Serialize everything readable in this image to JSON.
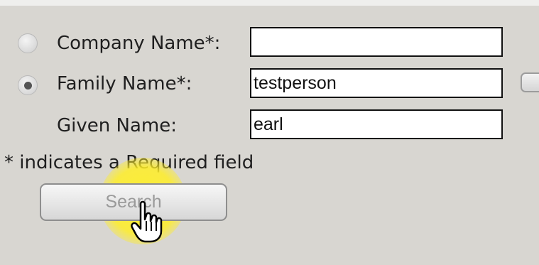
{
  "form": {
    "company": {
      "label": "Company Name*:",
      "value": "",
      "selected": false
    },
    "family": {
      "label": "Family Name*:",
      "value": "testperson",
      "selected": true
    },
    "given": {
      "label": "Given Name:",
      "value": "earl"
    },
    "required_note": "* indicates a Required field",
    "search_label": "Search"
  },
  "icons": {
    "cursor": "hand-pointer-icon"
  },
  "colors": {
    "background": "#d8d6d1",
    "click_highlight": "#fff02a"
  }
}
